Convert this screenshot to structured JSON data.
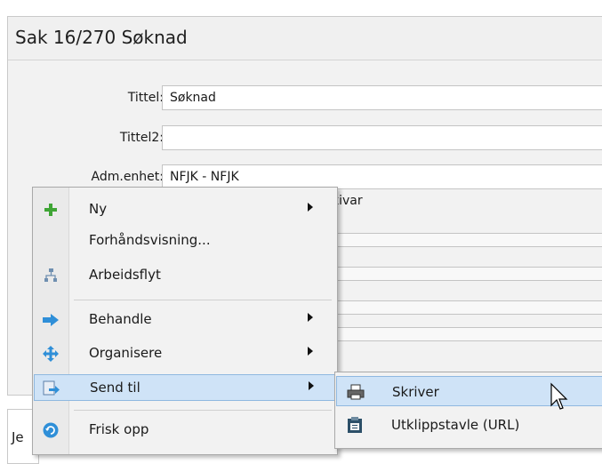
{
  "header": {
    "title": "Sak 16/270 Søknad"
  },
  "form": {
    "rows": [
      {
        "label": "Tittel:",
        "value": "Søknad"
      },
      {
        "label": "Tittel2:",
        "value": ""
      },
      {
        "label": "Adm.enhet:",
        "value": "NFJK - NFJK"
      }
    ],
    "partial_value": "kivar"
  },
  "below_panel": {
    "text": "Je"
  },
  "context_menu": {
    "items": [
      {
        "label": "Ny",
        "icon": "plus-icon",
        "has_submenu": true
      },
      {
        "label": "Forhåndsvisning...",
        "icon": "",
        "has_submenu": false
      },
      {
        "label": "Arbeidsflyt",
        "icon": "workflow-icon",
        "has_submenu": false
      },
      {
        "label": "Behandle",
        "icon": "arrow-right-icon",
        "has_submenu": true
      },
      {
        "label": "Organisere",
        "icon": "move-icon",
        "has_submenu": true
      },
      {
        "label": "Send til",
        "icon": "send-to-icon",
        "has_submenu": true,
        "highlighted": true
      },
      {
        "label": "Frisk opp",
        "icon": "refresh-icon",
        "has_submenu": false
      }
    ]
  },
  "submenu": {
    "items": [
      {
        "label": "Skriver",
        "icon": "printer-icon",
        "highlighted": true
      },
      {
        "label": "Utklippstavle (URL)",
        "icon": "clipboard-icon",
        "highlighted": false
      }
    ]
  },
  "colors": {
    "highlight_bg": "#cfe3f7",
    "highlight_border": "#8fb8e0",
    "accent_green": "#3fa535",
    "accent_blue": "#2f8fd8"
  }
}
